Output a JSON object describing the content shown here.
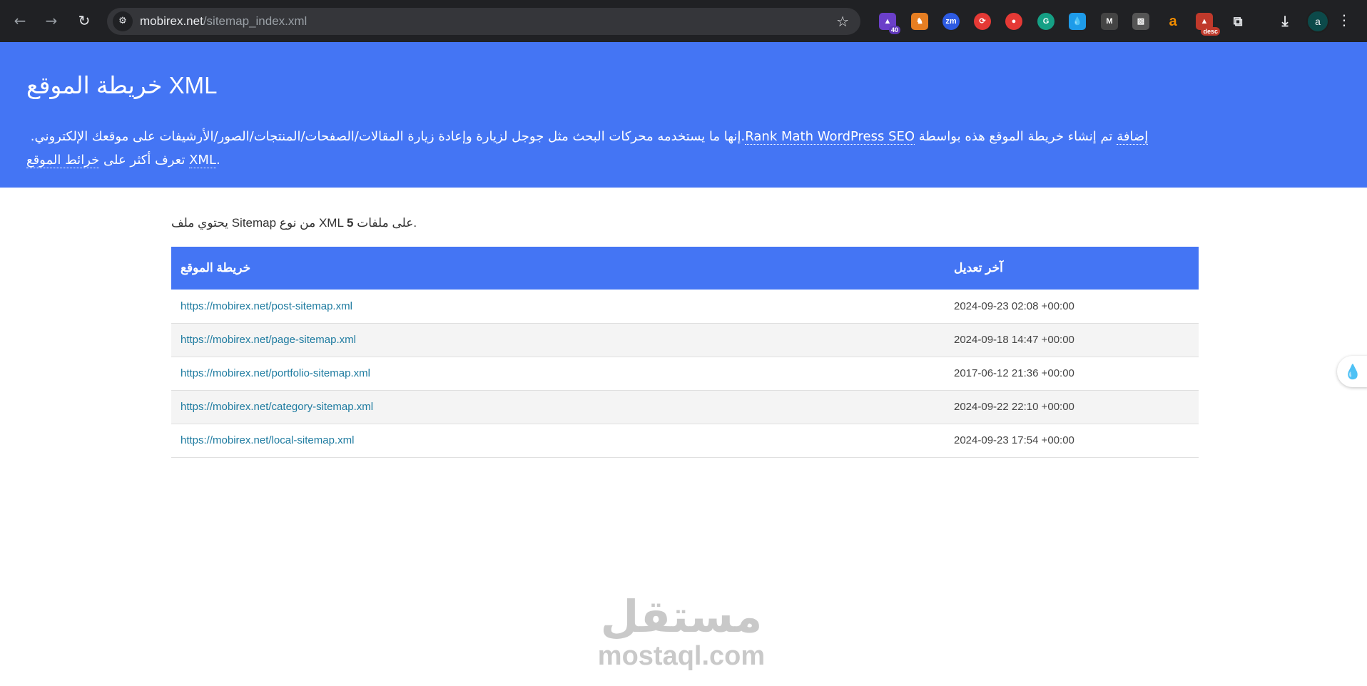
{
  "browser": {
    "url_domain": "mobirex.net",
    "url_path": "/sitemap_index.xml",
    "extension_badge_count": "40",
    "desc_badge": "desc",
    "avatar_letter": "a"
  },
  "header": {
    "title": "خريطة الموقع XML",
    "description_part1": ".إنها ما يستخدمه محركات البحث مثل جوجل لزيارة وإعادة زيارة المقالات/الصفحات/المنتجات/الصور/الأرشيفات على موقعك الإلكتروني. ",
    "link_rankmath": "Rank Math WordPress SEO",
    "description_part2": " تم إنشاء خريطة الموقع هذه بواسطة ",
    "link_addon": "إضافة",
    "description_part3": " تعرف أكثر على ",
    "link_sitemaps": "خرائط الموقع",
    "link_xml": "XML",
    "description_end": "."
  },
  "intro": {
    "text_before": "يحتوي ملف Sitemap من نوع XML ",
    "count": "5",
    "text_after": " على ملفات."
  },
  "table": {
    "col_sitemap": "خريطة الموقع",
    "col_lastmod": "آخر تعديل",
    "rows": [
      {
        "url": "https://mobirex.net/post-sitemap.xml",
        "lastmod": "2024-09-23 02:08 +00:00"
      },
      {
        "url": "https://mobirex.net/page-sitemap.xml",
        "lastmod": "2024-09-18 14:47 +00:00"
      },
      {
        "url": "https://mobirex.net/portfolio-sitemap.xml",
        "lastmod": "2017-06-12 21:36 +00:00"
      },
      {
        "url": "https://mobirex.net/category-sitemap.xml",
        "lastmod": "2024-09-22 22:10 +00:00"
      },
      {
        "url": "https://mobirex.net/local-sitemap.xml",
        "lastmod": "2024-09-23 17:54 +00:00"
      }
    ]
  },
  "watermark": {
    "arabic": "مستقل",
    "latin": "mostaql.com"
  },
  "colors": {
    "accent": "#4475f4",
    "link": "#1e7ba0",
    "chrome": "#202124"
  }
}
